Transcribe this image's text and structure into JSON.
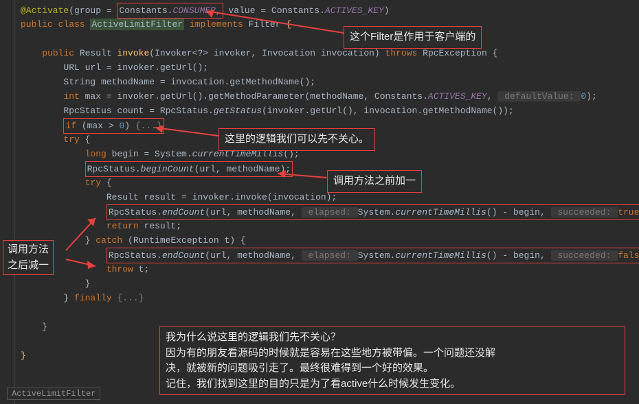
{
  "lines": {
    "l1a": "@Activate",
    "l1b": "(group = ",
    "l1_box": "Constants.CONSUMER,",
    "l1c": " value = Constants.",
    "l1_actives": "ACTIVES_KEY",
    "l1d": ")",
    "l2a": "public class ",
    "l2_class": "ActiveLimitFilter",
    "l2b": " implements ",
    "l2_filter": "Filter ",
    "l2_brace": "{",
    "l4": "    public Result invoke(Invoker<?> invoker, Invocation invocation) throws RpcException {",
    "l5": "        URL url = invoker.getUrl();",
    "l6": "        String methodName = invocation.getMethodName();",
    "l7": "        int max = invoker.getUrl().getMethodParameter(methodName, Constants.ACTIVES_KEY,  defaultValue: 0);",
    "l8": "        RpcStatus count = RpcStatus.getStatus(invoker.getUrl(), invocation.getMethodName());",
    "l9a": "        ",
    "l9_box": "if (max > 0) {...}",
    "l10": "        try {",
    "l11": "            long begin = System.currentTimeMillis();",
    "l12a": "            ",
    "l12_box": "RpcStatus.beginCount(url, methodName);",
    "l13": "            try {",
    "l14": "                Result result = invoker.invoke(invocation);",
    "l15a": "                ",
    "l15_box": "RpcStatus.endCount(url, methodName,  elapsed: System.currentTimeMillis() - begin,  succeeded: true);",
    "l16": "                return result;",
    "l17": "            } catch (RuntimeException t) {",
    "l18a": "                ",
    "l18_box": "RpcStatus.endCount(url, methodName,  elapsed: System.currentTimeMillis() - begin,  succeeded: false);",
    "l19": "                throw t;",
    "l20": "            }",
    "l21": "        } finally {...}",
    "l23": "    }",
    "l25": "}"
  },
  "callouts": {
    "c1": "这个Filter是作用于客户端的",
    "c2": "这里的逻辑我们可以先不关心。",
    "c3": "调用方法之前加一",
    "c4": "调用方法\n之后减一",
    "c5": "我为什么说这里的逻辑我们先不关心？\n因为有的朋友看源码的时候就是容易在这些地方被带偏。一个问题还没解\n决，就被新的问题吸引走了。最终很难得到一个好的效果。\n记住，我们找到这里的目的只是为了看active什么时候发生变化。"
  },
  "bottom_tag": "ActiveLimitFilter"
}
